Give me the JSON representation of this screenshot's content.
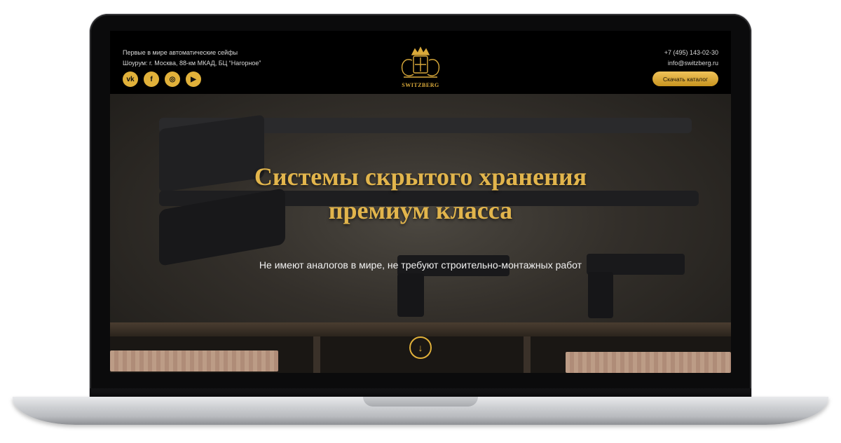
{
  "header": {
    "tagline": "Первые в мире  автоматические сейфы",
    "showroom": "Шоурум: г. Москва, 88-км МКАД, БЦ “Нагорное”",
    "phone": "+7 (495) 143-02-30",
    "email": "info@switzberg.ru",
    "catalog_button": "Скачать каталог",
    "brand": "SWITZBERG"
  },
  "social": [
    {
      "icon": "vk-icon",
      "glyph": "vk"
    },
    {
      "icon": "facebook-icon",
      "glyph": "f"
    },
    {
      "icon": "instagram-icon",
      "glyph": "◎"
    },
    {
      "icon": "youtube-icon",
      "glyph": "▶"
    }
  ],
  "hero": {
    "title_line1": "Системы скрытого хранения",
    "title_line2": "премиум класса",
    "subtitle": "Не имеют аналогов в мире, не требуют строительно-монтажных работ",
    "scroll_icon": "↓"
  },
  "colors": {
    "accent": "#e1b13a",
    "background": "#000000"
  }
}
